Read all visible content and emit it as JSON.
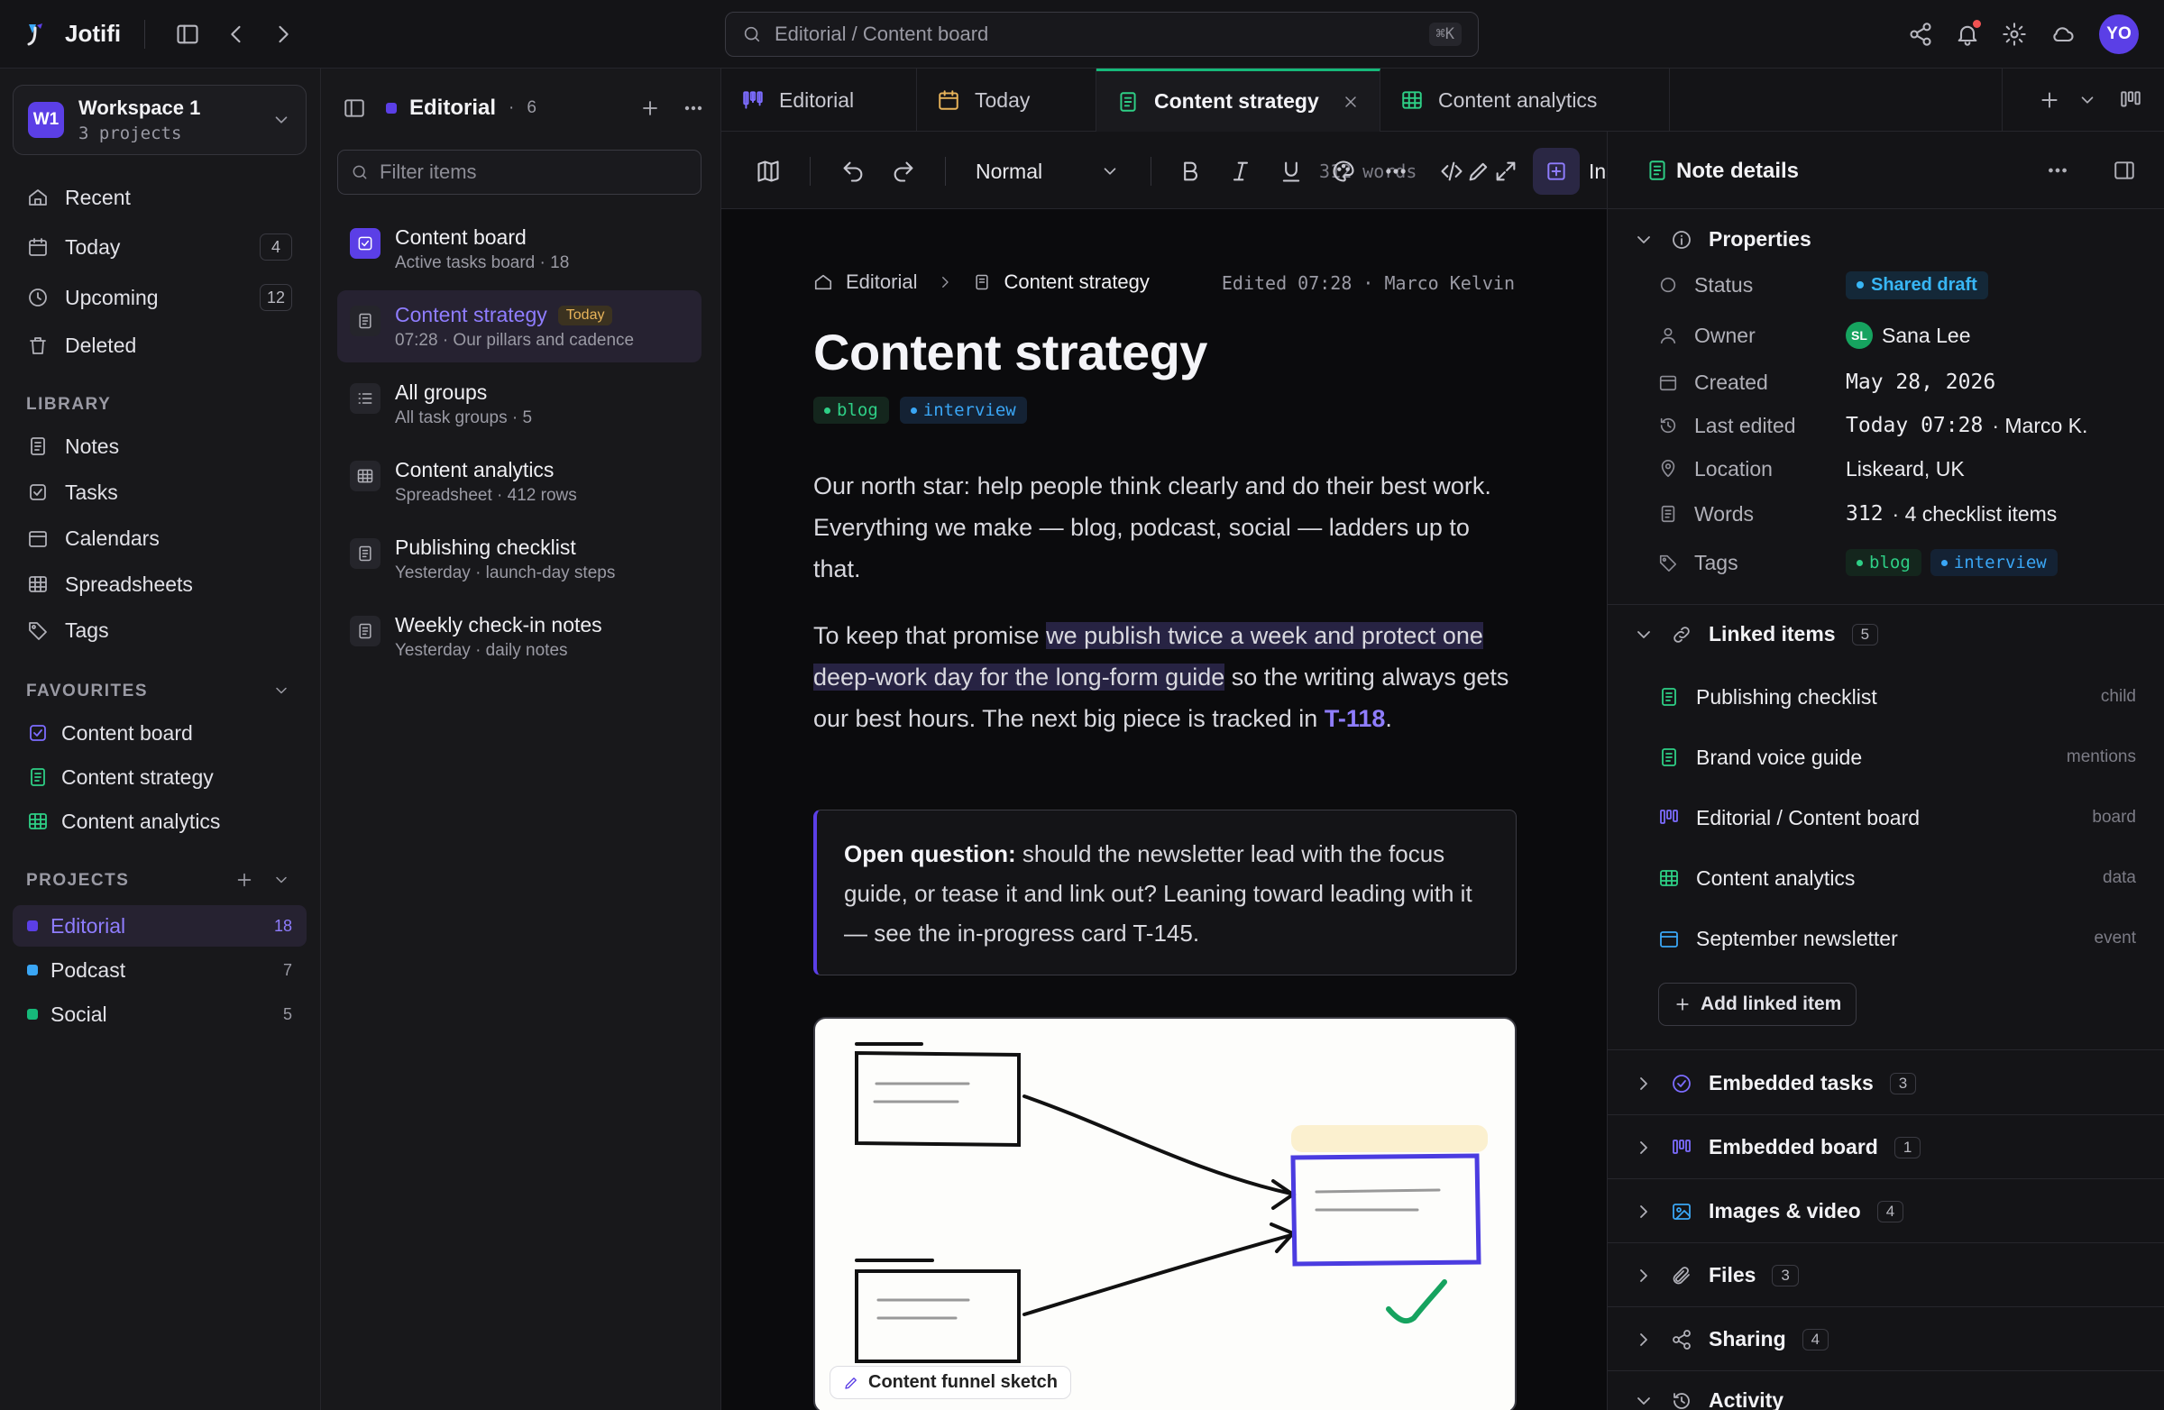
{
  "app": {
    "name": "Jotifi",
    "search_text": "Editorial / Content board",
    "search_shortcut": "⌘K",
    "avatar": "YO"
  },
  "workspace": {
    "badge": "W1",
    "name": "Workspace 1",
    "sub": "3 projects"
  },
  "nav": [
    {
      "label": "Recent",
      "icon": "clock-arrow-icon"
    },
    {
      "label": "Today",
      "icon": "calendar-icon",
      "count": "4"
    },
    {
      "label": "Upcoming",
      "icon": "clock-icon",
      "count": "12"
    },
    {
      "label": "Deleted",
      "icon": "trash-icon"
    }
  ],
  "library": {
    "heading": "LIBRARY",
    "items": [
      {
        "label": "Notes",
        "icon": "note-icon"
      },
      {
        "label": "Tasks",
        "icon": "checkbox-icon"
      },
      {
        "label": "Calendars",
        "icon": "calendar-icon"
      },
      {
        "label": "Spreadsheets",
        "icon": "grid-icon"
      },
      {
        "label": "Tags",
        "icon": "tag-icon"
      }
    ]
  },
  "favourites": {
    "heading": "FAVOURITES",
    "items": [
      {
        "label": "Content board",
        "icon": "checkbox-icon",
        "color": "#7c6cff"
      },
      {
        "label": "Content strategy",
        "icon": "note-icon",
        "color": "#2ecf86"
      },
      {
        "label": "Content analytics",
        "icon": "grid-icon",
        "color": "#2ecf86"
      }
    ]
  },
  "projects": {
    "heading": "PROJECTS",
    "items": [
      {
        "label": "Editorial",
        "count": "18",
        "color": "#5b3fe6"
      },
      {
        "label": "Podcast",
        "count": "7",
        "color": "#3aa6f5"
      },
      {
        "label": "Social",
        "count": "5",
        "color": "#16b97a"
      }
    ]
  },
  "list": {
    "title": "Editorial",
    "sep": "·",
    "count": "6",
    "filter_placeholder": "Filter items",
    "items": [
      {
        "title": "Content board",
        "sub": "Active tasks board · 18",
        "icon": "checkbox-icon"
      },
      {
        "title": "Content strategy",
        "sub": "07:28 · Our pillars and cadence",
        "badge": "Today",
        "icon": "note-icon"
      },
      {
        "title": "All groups",
        "sub": "All task groups · 5",
        "icon": "list-icon"
      },
      {
        "title": "Content analytics",
        "sub": "Spreadsheet · 412 rows",
        "icon": "grid-icon"
      },
      {
        "title": "Publishing checklist",
        "sub": "Yesterday · launch-day steps",
        "icon": "note-icon"
      },
      {
        "title": "Weekly check-in notes",
        "sub": "Yesterday · daily notes",
        "icon": "note-icon"
      }
    ]
  },
  "tabs": [
    {
      "label": "Editorial",
      "icon": "board-icon"
    },
    {
      "label": "Today",
      "icon": "calendar-icon"
    },
    {
      "label": "Content strategy",
      "icon": "note-icon"
    },
    {
      "label": "Content analytics",
      "icon": "grid-icon"
    }
  ],
  "toolbar": {
    "style": "Normal",
    "words": "312 words",
    "insert": "Insert"
  },
  "doc": {
    "crumb_root": "Editorial",
    "crumb_current": "Content strategy",
    "edited": "Edited 07:28 · Marco Kelvin",
    "title": "Content strategy",
    "tags": [
      "blog",
      "interview"
    ],
    "p1": "Our north star: help people think clearly and do their best work. Everything we make — blog, podcast, social — ladders up to that.",
    "p2_a": "To keep that promise ",
    "p2_hl": "we publish twice a week and protect one deep-work day for the long-form guide",
    "p2_b": " so the writing always gets our best hours. The next big piece is tracked in ",
    "p2_link": "T-118",
    "p2_end": ".",
    "callout_bold": "Open question:",
    "callout_text": " should the newsletter lead with the focus guide, or tease it and link out? Leaning toward leading with it — see the in-progress card T-145.",
    "sketch_caption": "Content funnel sketch"
  },
  "details": {
    "title": "Note details",
    "properties_heading": "Properties",
    "props": [
      {
        "key": "Status",
        "value": "Shared draft",
        "icon": "circle-icon"
      },
      {
        "key": "Owner",
        "value": "Sana Lee",
        "initials": "SL",
        "icon": "user-icon"
      },
      {
        "key": "Created",
        "value": "May 28, 2026",
        "icon": "calendar-icon"
      },
      {
        "key": "Last edited",
        "value_mono": "Today 07:28",
        "value_rest": " · Marco K.",
        "icon": "history-icon"
      },
      {
        "key": "Location",
        "value": "Liskeard, UK",
        "icon": "pin-icon"
      },
      {
        "key": "Words",
        "value_mono": "312",
        "value_rest": " · 4 checklist items",
        "icon": "note-icon"
      },
      {
        "key": "Tags",
        "tags": [
          "blog",
          "interview"
        ],
        "icon": "tag-icon"
      }
    ],
    "linked_heading": "Linked items",
    "linked_count": "5",
    "linked": [
      {
        "label": "Publishing checklist",
        "rel": "child",
        "icon": "note-icon",
        "color": "#2ecf86"
      },
      {
        "label": "Brand voice guide",
        "rel": "mentions",
        "icon": "note-icon",
        "color": "#2ecf86"
      },
      {
        "label": "Editorial / Content board",
        "rel": "board",
        "icon": "board-icon",
        "color": "#7c6cff"
      },
      {
        "label": "Content analytics",
        "rel": "data",
        "icon": "grid-icon",
        "color": "#2ecf86"
      },
      {
        "label": "September newsletter",
        "rel": "event",
        "icon": "calendar-icon",
        "color": "#3aa6f5"
      }
    ],
    "add_linked": "Add linked item",
    "sections": [
      {
        "label": "Embedded tasks",
        "count": "3",
        "icon": "check-circle-icon",
        "color": "#7c6cff"
      },
      {
        "label": "Embedded board",
        "count": "1",
        "icon": "board-icon",
        "color": "#7c6cff"
      },
      {
        "label": "Images & video",
        "count": "4",
        "icon": "image-icon",
        "color": "#3aa6f5"
      },
      {
        "label": "Files",
        "count": "3",
        "icon": "paperclip-icon",
        "color": "#b0b0b8"
      },
      {
        "label": "Sharing",
        "count": "4",
        "icon": "share-icon",
        "color": "#b0b0b8"
      },
      {
        "label": "Activity",
        "icon": "history-icon",
        "color": "#b0b0b8"
      }
    ]
  }
}
